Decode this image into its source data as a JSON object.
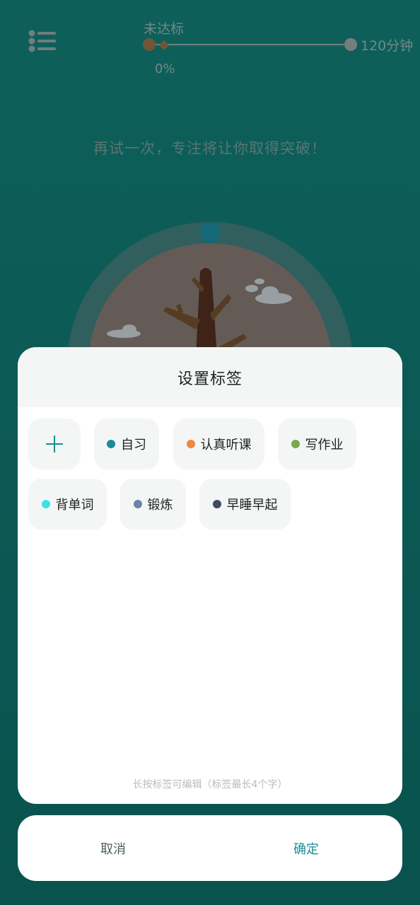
{
  "header": {
    "status": "未达标",
    "percent": "0%",
    "max_label": "120分钟",
    "progress_fraction": 0
  },
  "message": "再试一次，专注将让你取得突破！",
  "sheet": {
    "title": "设置标签",
    "hint": "长按标签可编辑（标签最长4个字）",
    "tags": [
      {
        "label": "自习",
        "color": "#1a8c9a"
      },
      {
        "label": "认真听课",
        "color": "#f0883a"
      },
      {
        "label": "写作业",
        "color": "#7aa84a"
      },
      {
        "label": "背单词",
        "color": "#3ee0ea"
      },
      {
        "label": "锻炼",
        "color": "#6a84a6"
      },
      {
        "label": "早睡早起",
        "color": "#3f4a60"
      }
    ]
  },
  "buttons": {
    "cancel": "取消",
    "confirm": "确定"
  },
  "colors": {
    "background": "#0f6f6a",
    "accent": "#1a8c9a"
  }
}
